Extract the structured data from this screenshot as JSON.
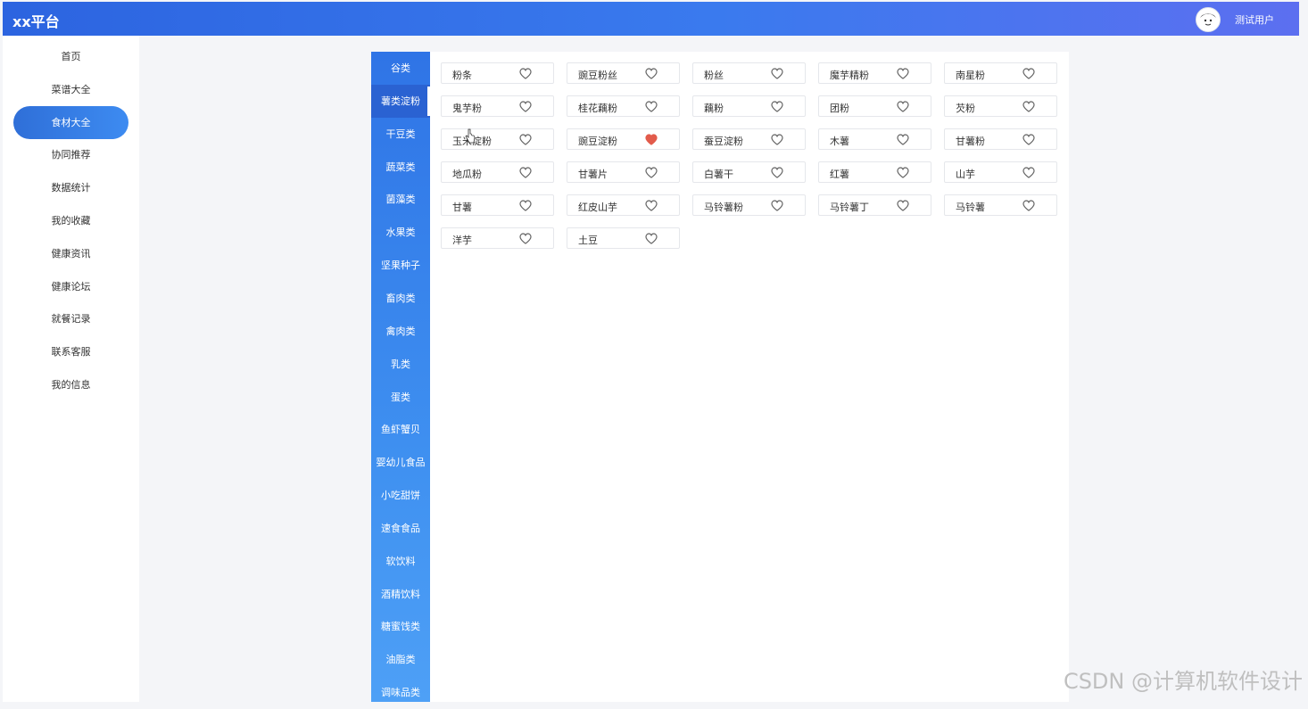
{
  "header": {
    "brand": "xx平台",
    "username": "测试用户"
  },
  "nav": [
    {
      "label": "首页",
      "active": false
    },
    {
      "label": "菜谱大全",
      "active": false
    },
    {
      "label": "食材大全",
      "active": true
    },
    {
      "label": "协同推荐",
      "active": false
    },
    {
      "label": "数据统计",
      "active": false
    },
    {
      "label": "我的收藏",
      "active": false
    },
    {
      "label": "健康资讯",
      "active": false
    },
    {
      "label": "健康论坛",
      "active": false
    },
    {
      "label": "就餐记录",
      "active": false
    },
    {
      "label": "联系客服",
      "active": false
    },
    {
      "label": "我的信息",
      "active": false
    }
  ],
  "categories": [
    {
      "label": "谷类",
      "active": false
    },
    {
      "label": "薯类淀粉",
      "active": true
    },
    {
      "label": "干豆类",
      "active": false
    },
    {
      "label": "蔬菜类",
      "active": false
    },
    {
      "label": "菌藻类",
      "active": false
    },
    {
      "label": "水果类",
      "active": false
    },
    {
      "label": "坚果种子",
      "active": false
    },
    {
      "label": "畜肉类",
      "active": false
    },
    {
      "label": "禽肉类",
      "active": false
    },
    {
      "label": "乳类",
      "active": false
    },
    {
      "label": "蛋类",
      "active": false
    },
    {
      "label": "鱼虾蟹贝",
      "active": false
    },
    {
      "label": "婴幼儿食品",
      "active": false
    },
    {
      "label": "小吃甜饼",
      "active": false
    },
    {
      "label": "速食食品",
      "active": false
    },
    {
      "label": "软饮料",
      "active": false
    },
    {
      "label": "酒精饮料",
      "active": false
    },
    {
      "label": "糖蜜饯类",
      "active": false
    },
    {
      "label": "油脂类",
      "active": false
    },
    {
      "label": "调味品类",
      "active": false
    }
  ],
  "foods": [
    {
      "name": "粉条",
      "favorited": false
    },
    {
      "name": "豌豆粉丝",
      "favorited": false
    },
    {
      "name": "粉丝",
      "favorited": false
    },
    {
      "name": "魔芋精粉",
      "favorited": false
    },
    {
      "name": "南星粉",
      "favorited": false
    },
    {
      "name": "鬼芋粉",
      "favorited": false
    },
    {
      "name": "桂花藕粉",
      "favorited": false
    },
    {
      "name": "藕粉",
      "favorited": false
    },
    {
      "name": "团粉",
      "favorited": false
    },
    {
      "name": "芡粉",
      "favorited": false
    },
    {
      "name": "玉米淀粉",
      "favorited": false
    },
    {
      "name": "豌豆淀粉",
      "favorited": true
    },
    {
      "name": "蚕豆淀粉",
      "favorited": false
    },
    {
      "name": "木薯",
      "favorited": false
    },
    {
      "name": "甘薯粉",
      "favorited": false
    },
    {
      "name": "地瓜粉",
      "favorited": false
    },
    {
      "name": "甘薯片",
      "favorited": false
    },
    {
      "name": "白薯干",
      "favorited": false
    },
    {
      "name": "红薯",
      "favorited": false
    },
    {
      "name": "山芋",
      "favorited": false
    },
    {
      "name": "甘薯",
      "favorited": false
    },
    {
      "name": "红皮山芋",
      "favorited": false
    },
    {
      "name": "马铃薯粉",
      "favorited": false
    },
    {
      "name": "马铃薯丁",
      "favorited": false
    },
    {
      "name": "马铃薯",
      "favorited": false
    },
    {
      "name": "洋芋",
      "favorited": false
    },
    {
      "name": "土豆",
      "favorited": false
    }
  ],
  "colors": {
    "heart_filled": "#e25b4b",
    "heart_outline": "#666666"
  },
  "watermark": "CSDN @计算机软件设计"
}
